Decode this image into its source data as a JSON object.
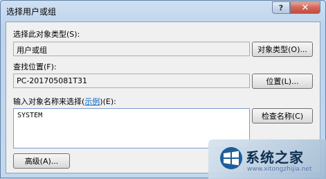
{
  "window": {
    "title": "选择用户或组",
    "help_button": "?",
    "close_button": "✕"
  },
  "object_type": {
    "label": "选择此对象类型(S):",
    "value": "用户或组",
    "button": "对象类型(O)..."
  },
  "location": {
    "label": "查找位置(F):",
    "value": "PC-201705081T31",
    "button": "位置(L)..."
  },
  "object_names": {
    "label_prefix": "输入对象名称来选择(",
    "label_link": "示例",
    "label_suffix": ")(E):",
    "value": "SYSTEM",
    "check_button": "检查名称(C)"
  },
  "footer": {
    "advanced_button": "高级(A)..."
  },
  "watermark": {
    "text": "系统之家",
    "url": "www.xitongzhijia.net"
  }
}
